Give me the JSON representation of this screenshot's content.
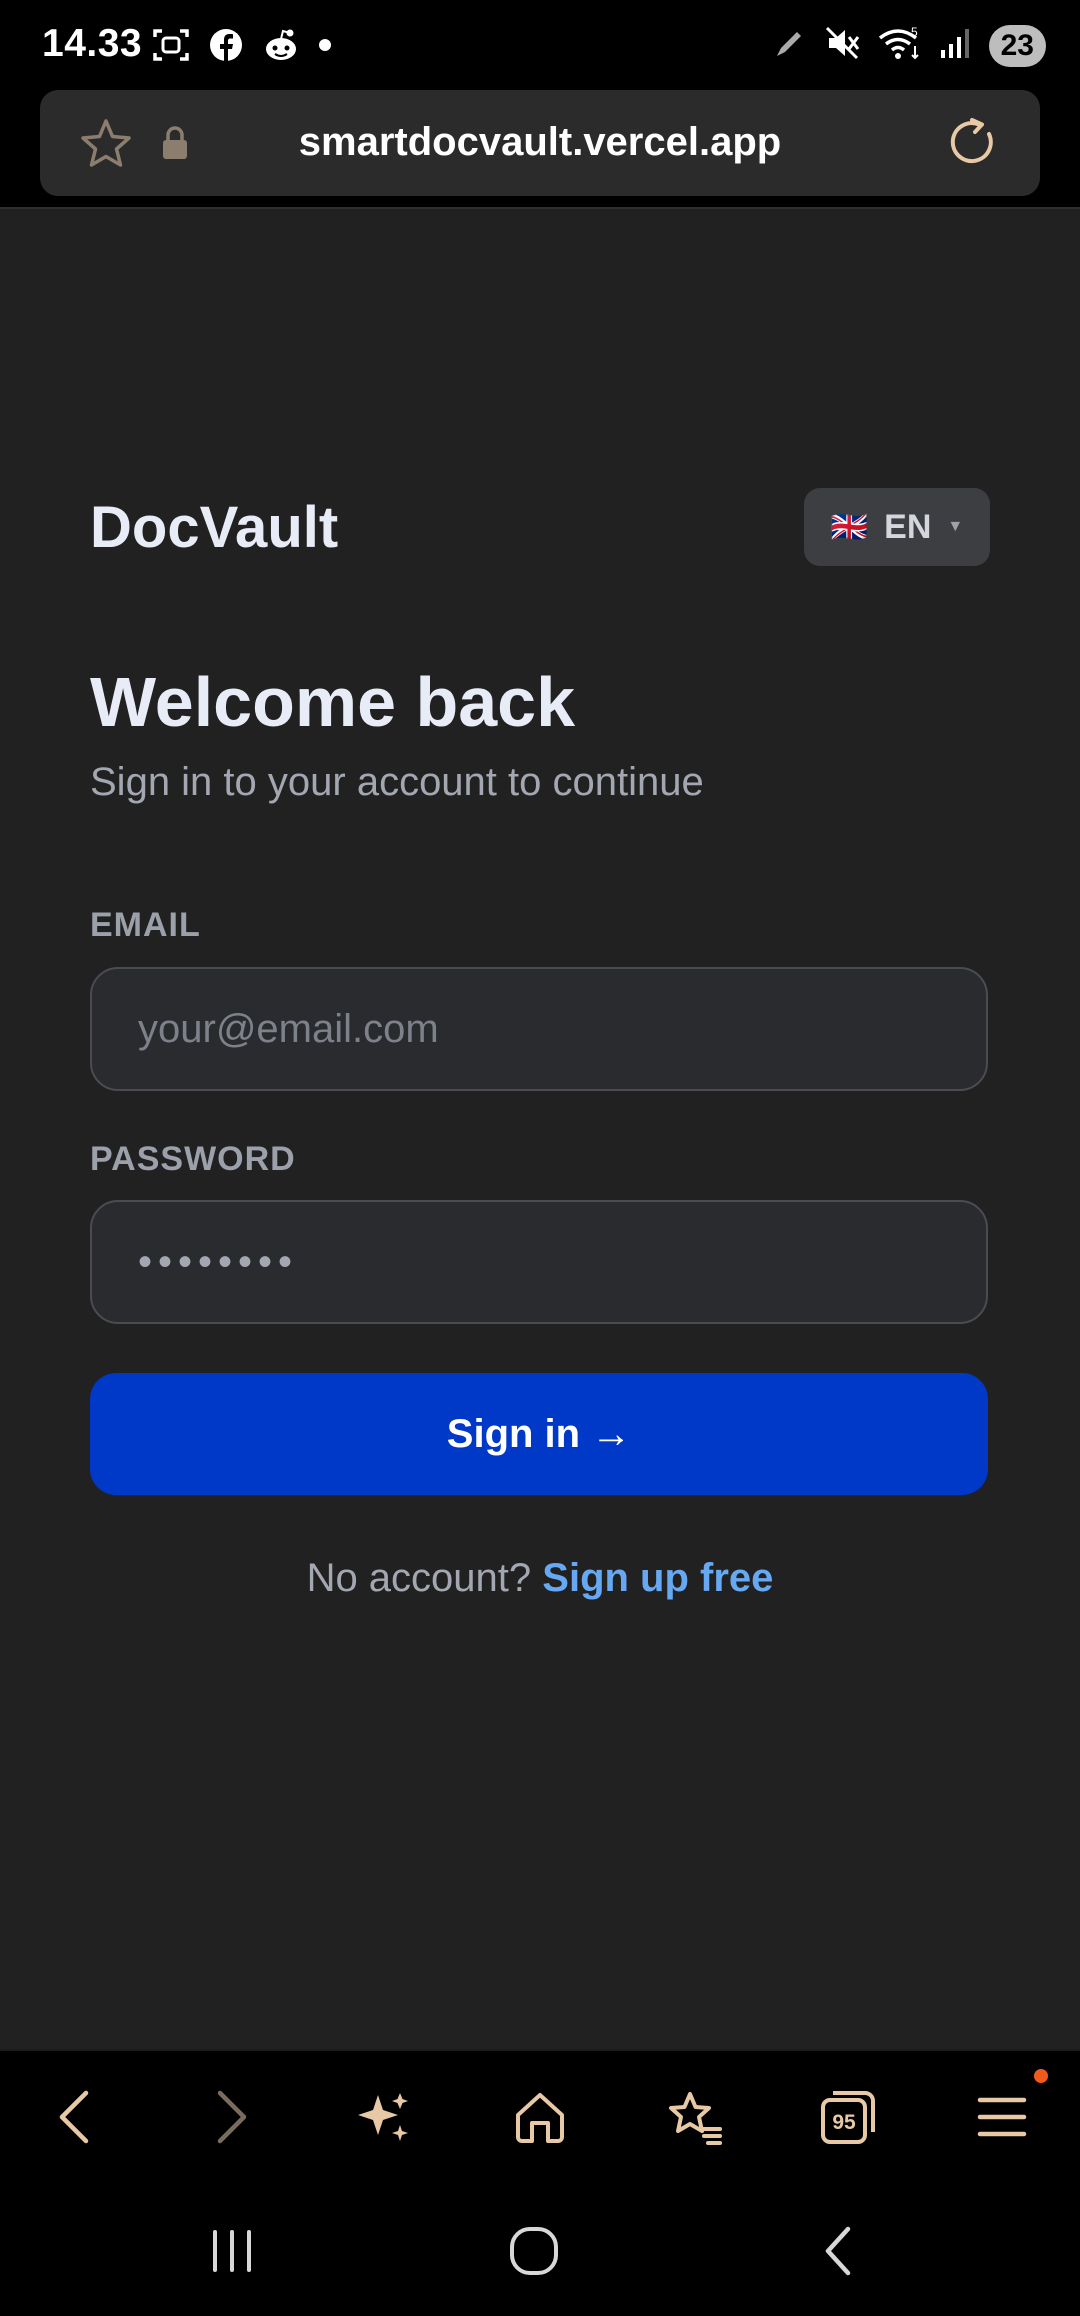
{
  "status_bar": {
    "time": "14.33",
    "battery": "23",
    "wifi_badge": "5"
  },
  "browser": {
    "url": "smartdocvault.vercel.app",
    "tab_count": "95"
  },
  "app": {
    "brand": "DocVault",
    "language": "EN",
    "language_flag": "🇬🇧"
  },
  "login": {
    "title": "Welcome back",
    "subtitle": "Sign in to your account to continue",
    "email_label": "EMAIL",
    "email_placeholder": "your@email.com",
    "password_label": "PASSWORD",
    "password_value": "••••••••",
    "submit_label": "Sign in →",
    "signup_prompt": "No account?",
    "signup_link": "Sign up free"
  },
  "colors": {
    "page_background": "#212121",
    "primary_button": "#0038c7",
    "link": "#66a8f2",
    "toolbar_icon": "#e8c9a6",
    "notification_dot": "#f25a1b"
  },
  "icons": {
    "status_left": [
      "screenshot-icon",
      "facebook-icon",
      "reddit-icon",
      "dot-icon"
    ],
    "status_right": [
      "pen-icon",
      "mute-icon",
      "wifi-icon",
      "signal-icon"
    ],
    "toolbar": [
      "back-icon",
      "forward-icon",
      "ai-sparkle-icon",
      "home-icon",
      "bookmarks-icon",
      "tabs-icon",
      "menu-icon"
    ],
    "system": [
      "recents-icon",
      "home-circle-icon",
      "system-back-icon"
    ]
  }
}
